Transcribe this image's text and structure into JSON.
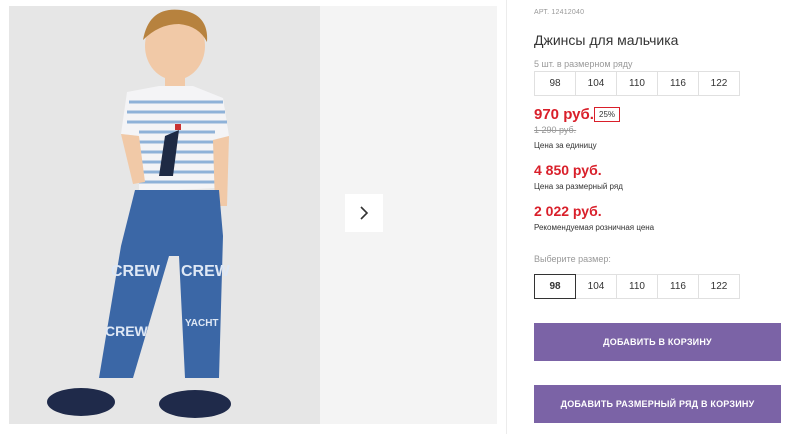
{
  "product": {
    "article": "АРТ. 12412040",
    "title": "Джинсы для мальчика",
    "size_row_note": "5 шт. в размерном ряду",
    "size_row": [
      "98",
      "104",
      "110",
      "116",
      "122"
    ]
  },
  "pricing": {
    "unit_price": "970 руб.",
    "discount": "25%",
    "old_price": "1 290 руб.",
    "unit_note": "Цена за единицу",
    "row_price": "4 850 руб.",
    "row_note": "Цена за размерный ряд",
    "retail_price": "2 022 руб.",
    "retail_note": "Рекомендуемая розничная цена",
    "accent_color": "#d91f2a"
  },
  "size_select": {
    "label": "Выберите размер:",
    "options": [
      "98",
      "104",
      "110",
      "116",
      "122"
    ],
    "selected": "98"
  },
  "actions": {
    "add_to_cart": "ДОБАВИТЬ В КОРЗИНУ",
    "add_row_to_cart": "ДОБАВИТЬ РАЗМЕРНЫЙ РЯД В КОРЗИНУ",
    "button_color": "#7b63a6"
  },
  "gallery": {
    "next_icon": "chevron-right-icon"
  }
}
